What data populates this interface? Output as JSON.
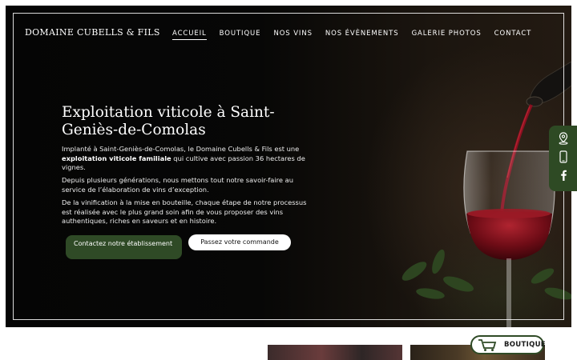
{
  "brand": "DOMAINE CUBELLS & FILS",
  "nav": [
    {
      "label": "ACCUEIL",
      "active": true
    },
    {
      "label": "BOUTIQUE"
    },
    {
      "label": "NOS VINS"
    },
    {
      "label": "NOS ÉVÈNEMENTS"
    },
    {
      "label": "GALERIE PHOTOS"
    },
    {
      "label": "CONTACT"
    }
  ],
  "hero": {
    "title": "Exploitation viticole à Saint-Geniès-de-Comolas",
    "p1_before": "Implanté à Saint-Geniès-de-Comolas, le Domaine Cubells & Fils est une ",
    "p1_bold": "exploitation viticole familiale",
    "p1_after": " qui cultive avec passion 36 hectares de vignes.",
    "p2": "Depuis plusieurs générations, nous mettons tout notre savoir-faire au service de l’élaboration de vins d’exception.",
    "p3": "De la vinification à la mise en bouteille, chaque étape de notre processus est réalisée avec le plus grand soin afin de vous proposer des vins authentiques, riches en saveurs et en histoire.",
    "btn_contact": "Contactez notre établissement",
    "btn_order": "Passez votre commande"
  },
  "social_icons": [
    "location-pin-icon",
    "phone-icon",
    "facebook-icon"
  ],
  "shop_button": {
    "label": "BOUTIQUE",
    "icon": "cart-icon"
  },
  "colors": {
    "accent_green": "#2f4a26",
    "hero_bg": "#060605",
    "wine_red": "#7a0f18"
  }
}
